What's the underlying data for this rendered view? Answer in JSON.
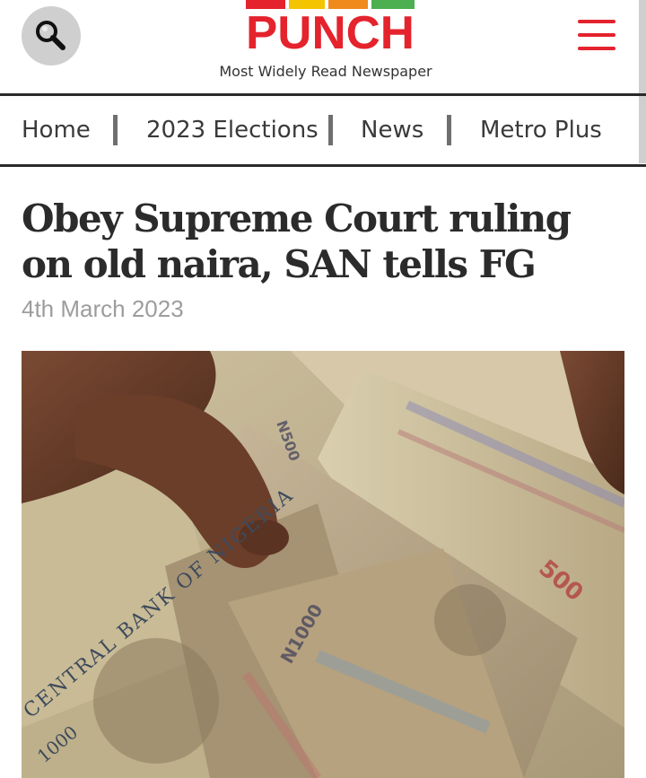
{
  "header": {
    "logo_text": "PUNCH",
    "tagline": "Most Widely Read Newspaper",
    "search_icon": "search-icon",
    "menu_icon": "hamburger-menu-icon",
    "brand_colors": {
      "red": "#e4232d",
      "yellow": "#f5c400",
      "orange": "#f08a1c",
      "green": "#4caf50"
    }
  },
  "nav": {
    "items": [
      {
        "label": "Home"
      },
      {
        "label": "2023 Elections"
      },
      {
        "label": "News"
      },
      {
        "label": "Metro Plus"
      }
    ]
  },
  "article": {
    "headline": "Obey Supreme Court ruling on old naira, SAN tells FG",
    "date": "4th March 2023",
    "image": {
      "text": [
        "CENTRAL BANK OF NIGERIA",
        "1000",
        "500",
        "N500",
        "N1000"
      ]
    }
  }
}
